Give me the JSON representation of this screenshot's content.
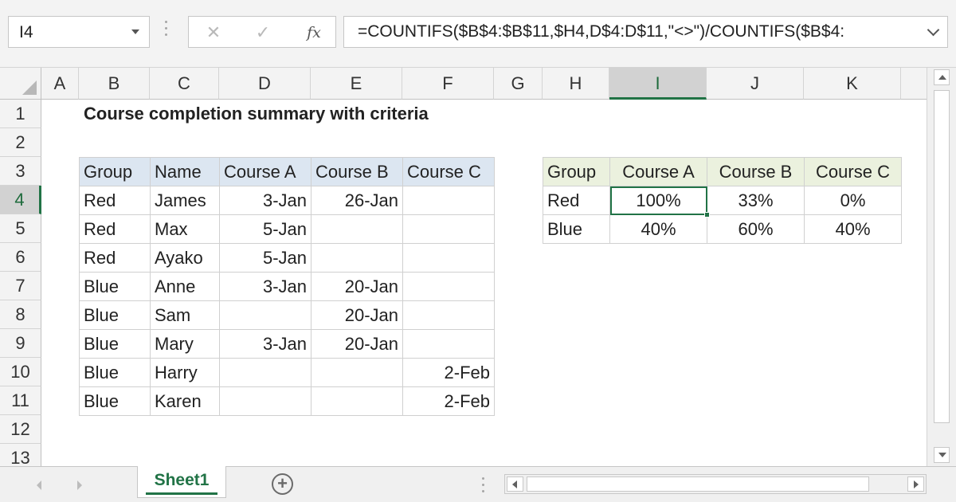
{
  "formula_bar": {
    "name_box": "I4",
    "cancel_icon": "✕",
    "enter_icon": "✓",
    "fx_label": "fx",
    "formula": "=COUNTIFS($B$4:$B$11,$H4,D$4:D$11,\"<>\")/COUNTIFS($B$4:"
  },
  "columns": [
    "A",
    "B",
    "C",
    "D",
    "E",
    "F",
    "G",
    "H",
    "I",
    "J",
    "K"
  ],
  "active_column": "I",
  "rows": [
    "1",
    "2",
    "3",
    "4",
    "5",
    "6",
    "7",
    "8",
    "9",
    "10",
    "11",
    "12",
    "13"
  ],
  "active_row": "4",
  "sheet_title": "Course completion summary with criteria",
  "data_table": {
    "headers": [
      "Group",
      "Name",
      "Course A",
      "Course B",
      "Course C"
    ],
    "rows": [
      [
        "Red",
        "James",
        "3-Jan",
        "26-Jan",
        ""
      ],
      [
        "Red",
        "Max",
        "5-Jan",
        "",
        ""
      ],
      [
        "Red",
        "Ayako",
        "5-Jan",
        "",
        ""
      ],
      [
        "Blue",
        "Anne",
        "3-Jan",
        "20-Jan",
        ""
      ],
      [
        "Blue",
        "Sam",
        "",
        "20-Jan",
        ""
      ],
      [
        "Blue",
        "Mary",
        "3-Jan",
        "20-Jan",
        ""
      ],
      [
        "Blue",
        "Harry",
        "",
        "",
        "2-Feb"
      ],
      [
        "Blue",
        "Karen",
        "",
        "",
        "2-Feb"
      ]
    ]
  },
  "summary_table": {
    "headers": [
      "Group",
      "Course A",
      "Course B",
      "Course C"
    ],
    "rows": [
      [
        "Red",
        "100%",
        "33%",
        "0%"
      ],
      [
        "Blue",
        "40%",
        "60%",
        "40%"
      ]
    ]
  },
  "selected_cell": "I4",
  "sheet_tabs": {
    "active": "Sheet1",
    "add_icon": "+"
  },
  "colors": {
    "accent": "#217346",
    "data_header_fill": "#dce6f1",
    "summary_header_fill": "#ebf1de"
  }
}
